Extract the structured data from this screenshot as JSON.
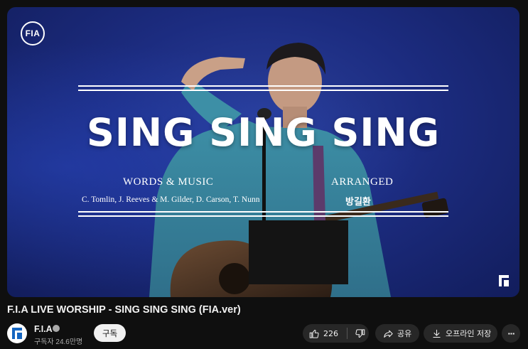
{
  "video": {
    "logo_text": "FIA",
    "title_text": "SING SING SING",
    "words_label": "WORDS & MUSIC",
    "credits": "C. Tomlin, J. Reeves & M. Gilder, D. Carson, T. Nunn",
    "arranged_label": "ARRANGED",
    "arranger": "방길환"
  },
  "meta": {
    "title": "F.I.A LIVE WORSHIP - SING SING SING (FIA.ver)",
    "channel_name": "F.I.A",
    "subscribers": "구독자 24.6만명",
    "subscribe_label": "구독"
  },
  "actions": {
    "like_count": "226",
    "share_label": "공유",
    "download_label": "오프라인 저장",
    "more_label": "···"
  },
  "colors": {
    "background": "#0f0f0f",
    "pill": "#272727",
    "video_blue": "#1c2c80"
  },
  "icons": [
    "thumbs-up-icon",
    "thumbs-down-icon",
    "share-icon",
    "download-icon",
    "more-icon",
    "verified-icon"
  ]
}
